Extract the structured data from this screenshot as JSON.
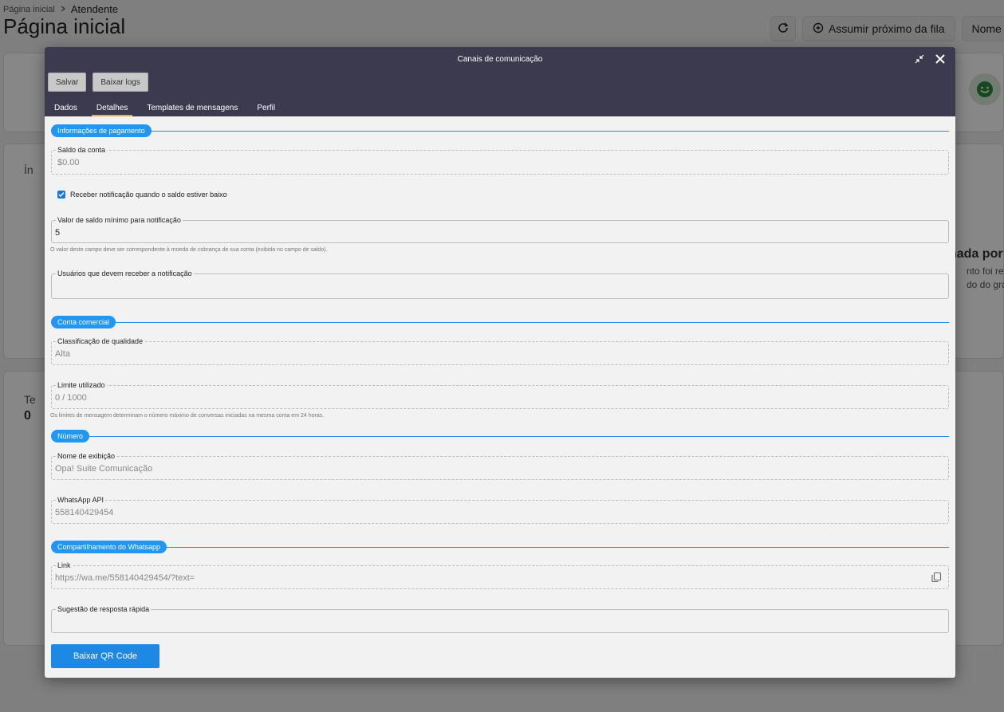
{
  "background": {
    "breadcrumb": {
      "home": "Página inicial",
      "current": "Atendente"
    },
    "page_title": "Página inicial",
    "actions": {
      "assume_next": "Assumir próximo da fila",
      "name_partial": "Nome d"
    },
    "card_text_1": "Ín",
    "card_text_2": "nada por",
    "card_text_3": "nto foi regis",
    "card_text_4": "do do gráfico",
    "card_text_5": "Te",
    "card_text_6": "0"
  },
  "modal": {
    "title": "Canais de comunicação",
    "buttons": {
      "save": "Salvar",
      "download_logs": "Baixar logs"
    },
    "tabs": [
      {
        "label": "Dados",
        "active": false
      },
      {
        "label": "Detalhes",
        "active": true
      },
      {
        "label": "Templates de mensagens",
        "active": false
      },
      {
        "label": "Perfil",
        "active": false
      }
    ],
    "sections": {
      "payment": "Informações de pagamento",
      "business_account": "Conta comercial",
      "number": "Número",
      "whatsapp_sharing": "Compartilhamento do Whatsapp"
    },
    "fields": {
      "balance": {
        "label": "Saldo da conta",
        "value": "$0.00"
      },
      "notify_checkbox": {
        "label": "Receber notificação quando o saldo estiver baixo",
        "checked": true
      },
      "min_balance": {
        "label": "Valor de saldo mínimo para notificação",
        "value": "5",
        "helper": "O valor deste campo deve ser correspondente à moeda de cobrança de sua conta (exibida no campo de saldo)."
      },
      "notify_users": {
        "label": "Usuários que devem receber a notificação",
        "value": ""
      },
      "quality": {
        "label": "Classificação de qualidade",
        "value": "Alta"
      },
      "limit": {
        "label": "Limite utilizado",
        "value": "0 / 1000",
        "helper": "Os limites de mensagem determinam o número máximo de conversas iniciadas na mesma conta em 24 horas."
      },
      "display_name": {
        "label": "Nome de exibição",
        "value": "Opa! Suite Comunicação"
      },
      "whatsapp_api": {
        "label": "WhatsApp API",
        "value": "558140429454"
      },
      "link": {
        "label": "Link",
        "value": "https://wa.me/558140429454/?text="
      },
      "quick_reply": {
        "label": "Sugestão de resposta rápida",
        "value": ""
      }
    },
    "qr_button": "Baixar QR Code"
  },
  "colors": {
    "header": "#3b3a4f",
    "accent": "#2196f3",
    "tab_indicator": "#f3a82f"
  },
  "icons": [
    "chevron-right-icon",
    "refresh-icon",
    "chat-plus-icon",
    "whatsapp-icon",
    "minimize-icon",
    "close-icon",
    "check-icon",
    "copy-icon"
  ]
}
